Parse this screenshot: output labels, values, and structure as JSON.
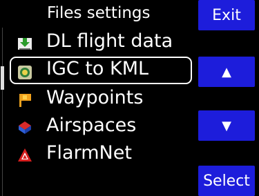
{
  "header": {
    "title": "Files settings"
  },
  "list": {
    "items": [
      {
        "label": "DL flight data",
        "icon": "download-icon"
      },
      {
        "label": "IGC to KML",
        "icon": "convert-icon",
        "selected": true
      },
      {
        "label": "Waypoints",
        "icon": "flag-icon"
      },
      {
        "label": "Airspaces",
        "icon": "airspace-icon"
      },
      {
        "label": "FlarmNet",
        "icon": "flarm-icon"
      }
    ]
  },
  "buttons": {
    "exit": "Exit",
    "up": "▲",
    "down": "▼",
    "select": "Select"
  },
  "colors": {
    "button_bg": "#1d1ddb",
    "background": "#000000"
  }
}
